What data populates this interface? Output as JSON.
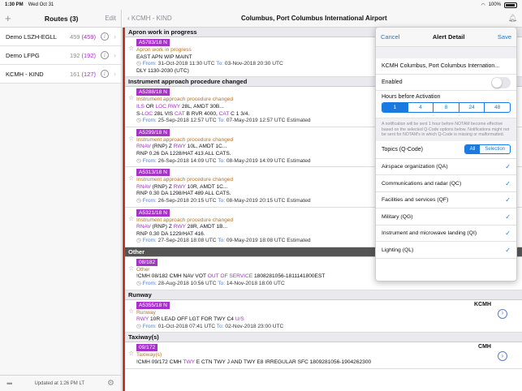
{
  "status": {
    "time": "1:30 PM",
    "date": "Wed Oct 31",
    "battery": "100%"
  },
  "left": {
    "add": "+",
    "title": "Routes (3)",
    "edit": "Edit",
    "routes": [
      {
        "name": "Demo LSZH-EGLL",
        "count": "459",
        "new": "(459)"
      },
      {
        "name": "Demo LFPG",
        "count": "192",
        "new": "(192)"
      },
      {
        "name": "KCMH - KIND",
        "count": "161",
        "new": "(127)"
      }
    ],
    "footer": "Updated at 1:26 PM LT"
  },
  "main": {
    "back": "KCMH - KIND",
    "title": "Columbus, Port Columbus International Airport",
    "sections": {
      "s1": "Apron work in progress",
      "s2": "Instrument approach procedure changed",
      "s3": "Other",
      "s4": "Runway",
      "s5": "Taxiway(s)"
    },
    "notams": {
      "n1": {
        "id": "A5783/18 N",
        "cat": "Apron work in progress",
        "l1": "EAST APN WIP MAINT",
        "from": "From:",
        "fromv": "31-Oct-2018 11:30 UTC",
        "to": "To:",
        "tov": "03-Nov-2018 20:30 UTC",
        "l3": "DLY 1130-2030 (UTC)"
      },
      "n2": {
        "id": "A5288/18 N",
        "cat": "Instrument approach procedure changed",
        "l1a": "ILS",
        "l1b": " OR ",
        "l1c": "LOC",
        "l1d": " ",
        "l1e": "RWY",
        "l1f": " 28L, AMDT 30B...",
        "l2a": "S-",
        "l2b": "LOC",
        "l2c": " 28L VIS ",
        "l2d": "CAT",
        "l2e": " B RVR 4000, ",
        "l2f": "CAT",
        "l2g": " C 1 3/4.",
        "from": "From:",
        "fromv": "25-Sep-2018 12:57 UTC",
        "to": "To:",
        "tov": "07-May-2019 12:57 UTC Estimated"
      },
      "n3": {
        "id": "A5299/18 N",
        "cat": "Instrument approach procedure changed",
        "l1a": "RNAV",
        "l1b": " (RNP) Z ",
        "l1c": "RWY",
        "l1d": " 10L, AMDT 1C...",
        "l2": "RNP 0.26 DA 1228/HAT 413 ALL CATS.",
        "from": "From:",
        "fromv": "26-Sep-2018 14:09 UTC",
        "to": "To:",
        "tov": "08-May-2019 14:09 UTC Estimated"
      },
      "n4": {
        "id": "A5313/18 N",
        "cat": "Instrument approach procedure changed",
        "l1a": "RNAV",
        "l1b": " (RNP) Z ",
        "l1c": "RWY",
        "l1d": " 10R, AMDT 1C...",
        "l2": "RNP 0.30 DA 1298/HAT 489 ALL CATS.",
        "from": "From:",
        "fromv": "26-Sep-2018 20:15 UTC",
        "to": "To:",
        "tov": "08-May-2019 20:15 UTC Estimated"
      },
      "n5": {
        "id": "A5321/18 N",
        "cat": "Instrument approach procedure changed",
        "l1a": "RNAV",
        "l1b": " (RNP) Z ",
        "l1c": "RWY",
        "l1d": " 28R, AMDT 1B...",
        "l2": "RNP 0.30 DA 1229/HAT 416.",
        "from": "From:",
        "fromv": "27-Sep-2018 18:08 UTC",
        "to": "To:",
        "tov": "09-May-2019 18:08 UTC Estimated"
      },
      "n6": {
        "id": "08/182",
        "cat": "Other",
        "l1a": "!CMH 08/182 CMH NAV VOT ",
        "l1b": "OUT OF SERVICE",
        "l1c": " 1808281056-1811141800EST",
        "from": "From:",
        "fromv": "28-Aug-2018 10:56 UTC",
        "to": "To:",
        "tov": "14-Nov-2018 18:00 UTC"
      },
      "n7": {
        "id": "A5355/18 N",
        "cat": "Runway",
        "apt": "KCMH",
        "l1a": "RWY",
        "l1b": " 10R LEAD OFF LGT FOR TWY C4 ",
        "l1c": "U/S",
        "from": "From:",
        "fromv": "01-Oct-2018 07:41 UTC",
        "to": "To:",
        "tov": "02-Nov-2018 23:00 UTC"
      },
      "n8": {
        "id": "09/172",
        "cat": "Taxiway(s)",
        "apt": "CMH",
        "l1a": "!CMH 09/172 CMH ",
        "l1b": "TWY",
        "l1c": " E CTN TWY J AND TWY E8 IRREGULAR SFC 1809281056-1904262300"
      }
    }
  },
  "popover": {
    "cancel": "Cancel",
    "title": "Alert Detail",
    "save": "Save",
    "airport": "KCMH Columbus, Port Columbus Internation...",
    "enabled": "Enabled",
    "hours_label": "Hours before Activation",
    "hours": [
      "1",
      "4",
      "8",
      "24",
      "48"
    ],
    "note": "A notification will be sent 1 hour before NOTAM become effective based on the selected Q-Code options below. Notifications might not be sent for NOTAM's in which Q-Code is missing or malformatted.",
    "topics_label": "Topics (Q-Code)",
    "all": "All",
    "selection": "Selection",
    "topics": [
      "Airspace organization (QA)",
      "Communications and radar (QC)",
      "Facilities and services (QF)",
      "Military (QG)",
      "Instrument and microwave landing (QI)",
      "Lighting (QL)"
    ]
  }
}
